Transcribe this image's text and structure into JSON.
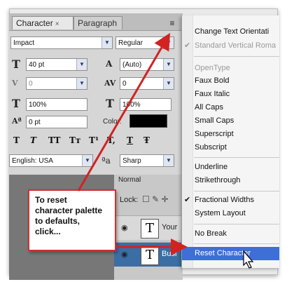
{
  "character_panel": {
    "tabs": [
      {
        "label": "Character",
        "close": "×"
      },
      {
        "label": "Paragraph"
      }
    ],
    "panel_menu_icon": "≡",
    "font_family": "Impact",
    "font_style": "Regular",
    "font_size": "40 pt",
    "leading": "(Auto)",
    "kerning": "0",
    "tracking": "0",
    "vertical_scale": "100%",
    "horizontal_scale": "100%",
    "baseline_shift": "0 pt",
    "color_label": "Color:",
    "color_value": "#000000",
    "type_styles": [
      "T",
      "T",
      "TT",
      "Tт",
      "T¹",
      "T,",
      "T",
      "Ŧ"
    ],
    "language": "English: USA",
    "aa_label": "ªa",
    "antialias": "Sharp"
  },
  "layers_panel": {
    "blend_mode": "Normal",
    "lock_label": "Lock:",
    "layers": [
      {
        "thumb": "T",
        "name": "Your"
      },
      {
        "thumb": "T",
        "name": "Busi"
      }
    ]
  },
  "flyout_menu": {
    "items": [
      {
        "label": "Change Text Orientati",
        "checked": false,
        "disabled": false
      },
      {
        "label": "Standard Vertical Roma",
        "checked": true,
        "disabled": true
      },
      {
        "label": "OpenType",
        "checked": false,
        "disabled": true
      },
      {
        "label": "Faux Bold",
        "checked": false,
        "disabled": false
      },
      {
        "label": "Faux Italic",
        "checked": false,
        "disabled": false
      },
      {
        "label": "All Caps",
        "checked": false,
        "disabled": false
      },
      {
        "label": "Small Caps",
        "checked": false,
        "disabled": false
      },
      {
        "label": "Superscript",
        "checked": false,
        "disabled": false
      },
      {
        "label": "Subscript",
        "checked": false,
        "disabled": false
      },
      {
        "label": "Underline",
        "checked": false,
        "disabled": false
      },
      {
        "label": "Strikethrough",
        "checked": false,
        "disabled": false
      },
      {
        "label": "Fractional Widths",
        "checked": true,
        "disabled": false
      },
      {
        "label": "System Layout",
        "checked": false,
        "disabled": false
      },
      {
        "label": "No Break",
        "checked": false,
        "disabled": false
      },
      {
        "label": "Reset Character",
        "checked": false,
        "disabled": false,
        "highlighted": true
      }
    ]
  },
  "callout": {
    "lines": [
      "To reset",
      "character palette",
      "to defaults,",
      "click..."
    ]
  },
  "colors": {
    "menu_highlight": "#3d6fd6",
    "arrow": "#d32222",
    "selected_layer": "#3a6ea5"
  }
}
